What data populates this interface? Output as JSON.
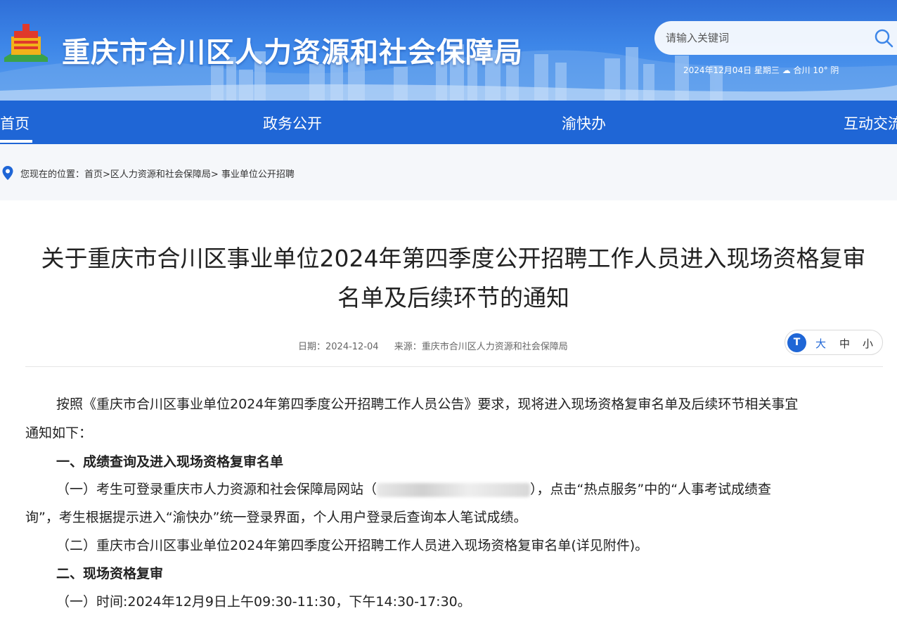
{
  "header": {
    "site_title": "重庆市合川区人力资源和社会保障局",
    "search_placeholder": "请输入关键词",
    "date_weather": "2024年12月04日 星期三 ☁ 合川 10° 阴"
  },
  "nav": {
    "items": [
      {
        "label": "首页"
      },
      {
        "label": "政务公开"
      },
      {
        "label": "渝快办"
      },
      {
        "label": "互动交流"
      }
    ]
  },
  "breadcrumb": {
    "text": "您现在的位置：首页>区人力资源和社会保障局> 事业单位公开招聘"
  },
  "article": {
    "title_line1": "关于重庆市合川区事业单位2024年第四季度公开招聘工作人员进入现场资格复审",
    "title_line2": "名单及后续环节的通知",
    "date": "日期：2024-12-04",
    "source": "来源：重庆市合川区人力资源和社会保障局",
    "font_size": {
      "icon": "T",
      "large": "大",
      "medium": "中",
      "small": "小"
    },
    "paragraphs": {
      "intro_1": "按照《重庆市合川区事业单位2024年第四季度公开招聘工作人员公告》要求，现将进入现场资格复审名单及后续环节相关事宜",
      "intro_2": "通知如下：",
      "heading_1": "一、成绩查询及进入现场资格复审名单",
      "item_1a_pre": "（一）考生可登录重庆市人力资源和社会保障局网站（",
      "item_1a_post": "），点击“热点服务”中的“人事考试成绩查",
      "item_1a_cont": "询”，考生根据提示进入“渝快办”统一登录界面，个人用户登录后查询本人笔试成绩。",
      "item_1b": "（二）重庆市合川区事业单位2024年第四季度公开招聘工作人员进入现场资格复审名单(详见附件)。",
      "heading_2": "二、现场资格复审",
      "item_2a": "（一）时间:2024年12月9日上午09:30-11:30，下午14:30-17:30。"
    }
  },
  "colors": {
    "nav_bg": "#1f66d6",
    "banner": "#3d86e8"
  }
}
